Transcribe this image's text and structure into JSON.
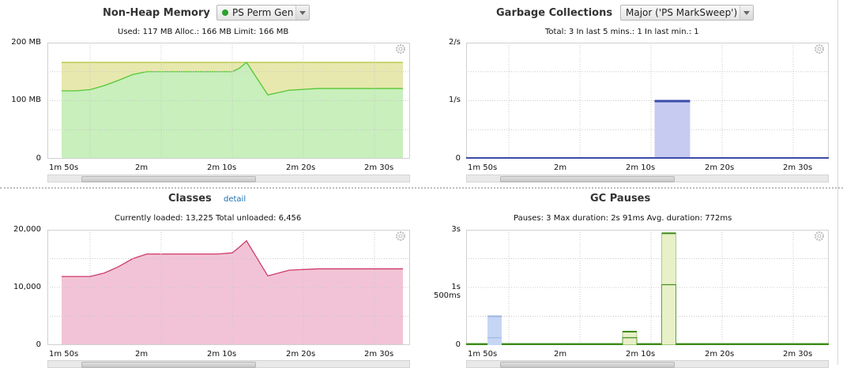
{
  "colors": {
    "heap_fill": "#c8efbc",
    "heap_line": "#55c734",
    "alloc_fill": "#e6e8ae",
    "alloc_line": "#b1c43a",
    "class_fill": "#f2c3d6",
    "class_line": "#cf3b6b",
    "gc_fill": "#c7cbf2",
    "gc_line": "#3a4ba8",
    "pause_line": "#3d8a17",
    "pause_fill": "#e8f0c8"
  },
  "panels": {
    "nonheap": {
      "title": "Non-Heap Memory",
      "pool_select": "PS Perm Gen",
      "stats": "Used: 117 MB    Alloc.: 166 MB    Limit: 166 MB",
      "y_labels": [
        "200 MB",
        "100 MB",
        "0"
      ],
      "x_labels": [
        "1m 50s",
        "2m",
        "2m 10s",
        "2m 20s",
        "2m 30s"
      ]
    },
    "gc": {
      "title": "Garbage Collections",
      "type_select": "Major ('PS MarkSweep')",
      "stats": "Total: 3    In last 5 mins.: 1    In last min.: 1",
      "y_labels": [
        "2/s",
        "1/s",
        "0"
      ],
      "x_labels": [
        "1m 50s",
        "2m",
        "2m 10s",
        "2m 20s",
        "2m 30s"
      ]
    },
    "classes": {
      "title": "Classes",
      "detail_link": "detail",
      "stats": "Currently loaded: 13,225    Total unloaded: 6,456",
      "y_labels": [
        "20,000",
        "10,000",
        "0"
      ],
      "x_labels": [
        "1m 50s",
        "2m",
        "2m 10s",
        "2m 20s",
        "2m 30s"
      ]
    },
    "pauses": {
      "title": "GC Pauses",
      "stats": "Pauses: 3    Max duration: 2s 91ms    Avg. duration: 772ms",
      "y_labels": [
        "3s",
        "1s 500ms",
        "0"
      ],
      "x_labels": [
        "1m 50s",
        "2m",
        "2m 10s",
        "2m 20s",
        "2m 30s"
      ]
    }
  },
  "chart_data": [
    {
      "type": "area",
      "title": "Non-Heap Memory",
      "xlabel": "",
      "ylabel": "",
      "x": [
        "1m 46s",
        "1m 48s",
        "1m 50s",
        "1m 52s",
        "1m 54s",
        "1m 56s",
        "1m 58s",
        "2m",
        "2m 2s",
        "2m 4s",
        "2m 6s",
        "2m 8s",
        "2m 10s",
        "2m 11s",
        "2m 12s",
        "2m 15s",
        "2m 18s",
        "2m 22s",
        "2m 26s",
        "2m 30s",
        "2m 34s"
      ],
      "x_seconds": [
        106,
        108,
        110,
        112,
        114,
        116,
        118,
        120,
        122,
        124,
        126,
        128,
        130,
        131,
        132,
        135,
        138,
        142,
        146,
        150,
        154
      ],
      "ylim": [
        0,
        200
      ],
      "y_unit": "MB",
      "series": [
        {
          "name": "Used",
          "values": [
            117,
            117,
            119,
            126,
            135,
            145,
            150,
            150,
            150,
            150,
            150,
            150,
            150,
            156,
            166,
            110,
            118,
            121,
            121,
            121,
            121
          ]
        },
        {
          "name": "Alloc.",
          "values": [
            166,
            166,
            166,
            166,
            166,
            166,
            166,
            166,
            166,
            166,
            166,
            166,
            166,
            166,
            166,
            166,
            166,
            166,
            166,
            166,
            166
          ]
        }
      ]
    },
    {
      "type": "bar",
      "title": "Garbage Collections",
      "xlabel": "",
      "ylabel": "",
      "x_seconds": [
        133
      ],
      "bar_width_seconds": 5,
      "values": [
        1
      ],
      "ylim": [
        0,
        2
      ],
      "y_unit": "/s"
    },
    {
      "type": "area",
      "title": "Classes",
      "xlabel": "",
      "ylabel": "",
      "x_seconds": [
        106,
        108,
        110,
        112,
        114,
        116,
        118,
        120,
        122,
        124,
        126,
        128,
        130,
        131,
        132,
        135,
        138,
        142,
        146,
        150,
        154
      ],
      "ylim": [
        0,
        20000
      ],
      "series": [
        {
          "name": "Currently loaded",
          "values": [
            11900,
            11900,
            11900,
            12500,
            13600,
            15000,
            15800,
            15800,
            15800,
            15800,
            15800,
            15800,
            16000,
            17000,
            18100,
            12000,
            13000,
            13225,
            13225,
            13225,
            13225
          ]
        }
      ]
    },
    {
      "type": "bar",
      "title": "GC Pauses",
      "xlabel": "",
      "ylabel": "",
      "ylim": [
        0,
        3
      ],
      "y_unit": "s",
      "bars": [
        {
          "x_seconds": 108,
          "width_seconds": 2,
          "total": 0.75,
          "segments": [
            0.2,
            0.55
          ]
        },
        {
          "x_seconds": 127,
          "width_seconds": 2,
          "total": 0.35,
          "segments": [
            0.2,
            0.15
          ]
        },
        {
          "x_seconds": 132.5,
          "width_seconds": 2,
          "total": 2.91,
          "segments": [
            1.58,
            1.33
          ]
        }
      ],
      "baseline": 0.05
    }
  ]
}
